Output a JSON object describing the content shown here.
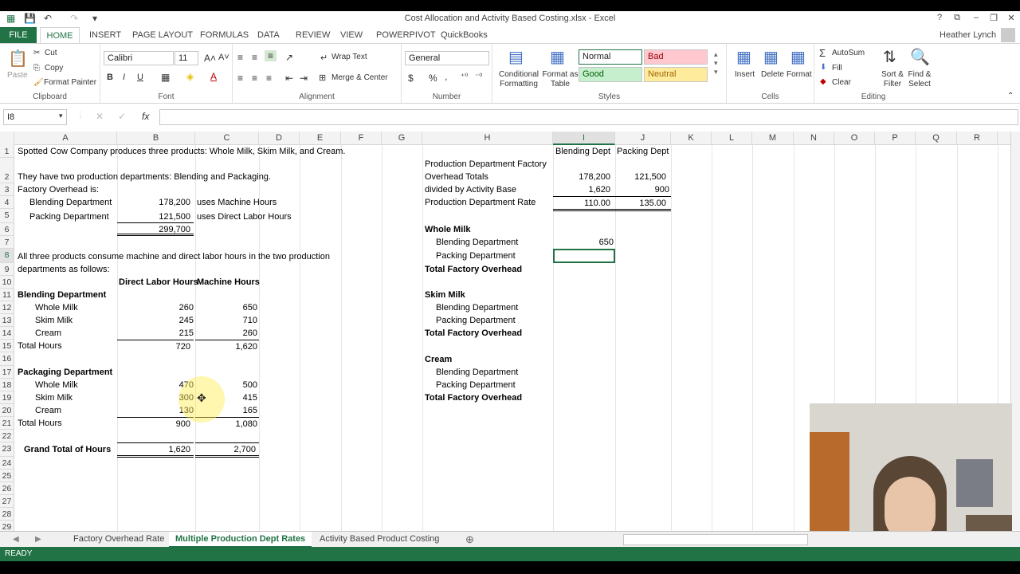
{
  "window": {
    "title": "Cost Allocation and Activity Based Costing.xlsx - Excel"
  },
  "ribbon_tabs": {
    "file": "FILE",
    "home": "HOME",
    "insert": "INSERT",
    "page_layout": "PAGE LAYOUT",
    "formulas": "FORMULAS",
    "data": "DATA",
    "review": "REVIEW",
    "view": "VIEW",
    "powerpivot": "POWERPIVOT",
    "quickbooks": "QuickBooks",
    "user": "Heather Lynch"
  },
  "clipboard": {
    "paste": "Paste",
    "cut": "Cut",
    "copy": "Copy",
    "format_painter": "Format Painter",
    "label": "Clipboard"
  },
  "font": {
    "name": "Calibri",
    "size": "11",
    "label": "Font",
    "bold": "B",
    "italic": "I",
    "underline": "U"
  },
  "alignment": {
    "wrap_text": "Wrap Text",
    "merge_center": "Merge & Center",
    "label": "Alignment"
  },
  "number": {
    "format": "General",
    "label": "Number",
    "currency": "$",
    "percent": "%",
    "comma": ","
  },
  "styles": {
    "conditional": "Conditional Formatting",
    "format_table": "Format as Table",
    "normal": "Normal",
    "bad": "Bad",
    "good": "Good",
    "neutral": "Neutral",
    "label": "Styles"
  },
  "cells_grp": {
    "insert": "Insert",
    "delete": "Delete",
    "format": "Format",
    "label": "Cells"
  },
  "editing": {
    "autosum": "AutoSum",
    "fill": "Fill",
    "clear": "Clear",
    "sort": "Sort & Filter",
    "find": "Find & Select",
    "label": "Editing"
  },
  "formula_bar": {
    "name_box": "I8",
    "fx": "fx",
    "value": ""
  },
  "columns": [
    "A",
    "B",
    "C",
    "D",
    "E",
    "F",
    "G",
    "H",
    "I",
    "J",
    "K",
    "L",
    "M",
    "N",
    "O",
    "P",
    "Q",
    "R"
  ],
  "rows": [
    "1",
    "2",
    "3",
    "4",
    "5",
    "6",
    "7",
    "8",
    "9",
    "10",
    "11",
    "12",
    "13",
    "14",
    "15",
    "16",
    "17",
    "18",
    "19",
    "20",
    "21",
    "22",
    "23",
    "24",
    "25",
    "26",
    "27",
    "28",
    "29"
  ],
  "cells": {
    "a1": "Spotted Cow Company produces three products:  Whole Milk, Skim Milk, and Cream.",
    "a2": "They have two production departments:  Blending and Packaging.",
    "a3": "Factory Overhead is:",
    "a4": "Blending Department",
    "b4": "178,200",
    "c4": "uses Machine Hours",
    "a5": "Packing Department",
    "b5": "121,500",
    "c5": "uses Direct Labor Hours",
    "b6": "299,700",
    "a8": "All three products consume machine and direct labor hours in the two production",
    "a9": "departments as follows:",
    "b10": "Direct Labor Hours",
    "c10": "Machine Hours",
    "a11": "Blending Department",
    "a12": "Whole Milk",
    "b12": "260",
    "c12": "650",
    "a13": "Skim Milk",
    "b13": "245",
    "c13": "710",
    "a14": "Cream",
    "b14": "215",
    "c14": "260",
    "a15": "Total Hours",
    "b15": "720",
    "c15": "1,620",
    "a17": "Packaging Department",
    "a18": "Whole Milk",
    "b18": "470",
    "c18": "500",
    "a19": "Skim Milk",
    "b19": "300",
    "c19": "415",
    "a20": "Cream",
    "b20": "130",
    "c20": "165",
    "a21": "Total Hours",
    "b21": "900",
    "c21": "1,080",
    "a23": "Grand Total of Hours",
    "b23": "1,620",
    "c23": "2,700",
    "i1": "Blending Dept",
    "j1": "Packing Dept",
    "h1b": "Production Department Factory",
    "h2": "Overhead Totals",
    "i2": "178,200",
    "j2": "121,500",
    "h3": "divided by Activity Base",
    "i3": "1,620",
    "j3": "900",
    "h4": "Production Department Rate",
    "i4": "110.00",
    "j4": "135.00",
    "h6": "Whole Milk",
    "h7": "Blending Department",
    "i7": "650",
    "h8": "Packing Department",
    "h9": "Total Factory Overhead",
    "h11": "Skim Milk",
    "h12": "Blending Department",
    "h13": "Packing Department",
    "h14": "Total Factory Overhead",
    "h16": "Cream",
    "h17": "Blending Department",
    "h18": "Packing Department",
    "h19": "Total Factory Overhead"
  },
  "sheets": [
    "Factory Overhead Rate",
    "Multiple Production Dept Rates",
    "Activity Based Product Costing"
  ],
  "status": {
    "mode": "READY"
  }
}
